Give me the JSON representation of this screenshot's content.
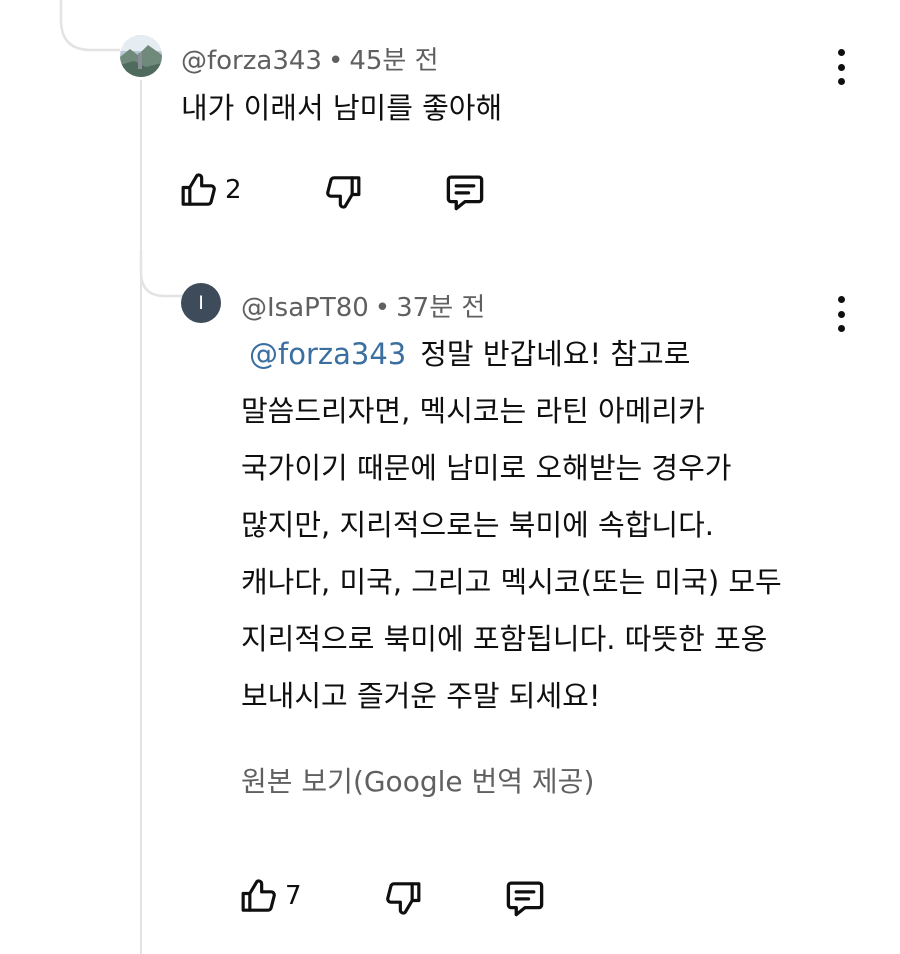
{
  "comment": {
    "author": "@forza343",
    "separator": "•",
    "time": "45분 전",
    "text": "내가 이래서 남미를 좋아해",
    "like_count": "2",
    "avatar_icon": "landscape-photo-avatar"
  },
  "reply": {
    "avatar_letter": "I",
    "avatar_color": "#3d4b5a",
    "author": "@IsaPT80",
    "separator": "•",
    "time": "37분 전",
    "mention": "@forza343",
    "lines": [
      "정말 반갑네요! 참고로",
      "말씀드리자면, 멕시코는 라틴 아메리카",
      "국가이기 때문에 남미로 오해받는 경우가",
      "많지만, 지리적으로는 북미에 속합니다.",
      "캐나다, 미국, 그리고 멕시코(또는 미국) 모두",
      "지리적으로 북미에 포함됩니다. 따뜻한 포옹",
      "보내시고 즐거운 주말 되세요!"
    ],
    "see_original": "원본 보기(Google 번역 제공)",
    "like_count": "7"
  },
  "colors": {
    "mention": "#3a6fa0",
    "meta": "#606060",
    "thread_line": "#e3e3e3"
  }
}
